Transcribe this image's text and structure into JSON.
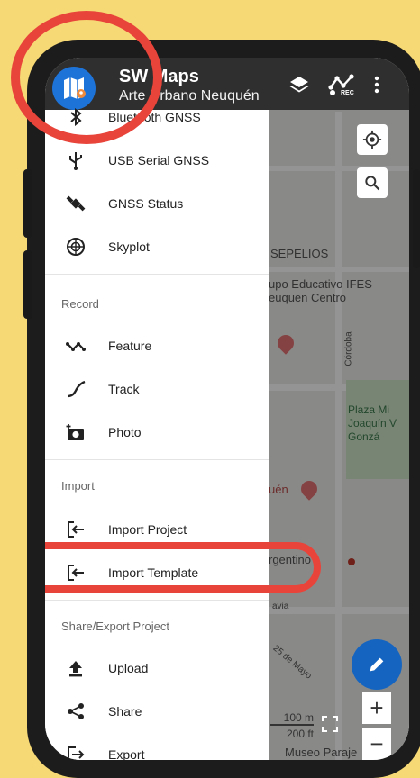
{
  "app": {
    "title": "SW Maps",
    "project": "Arte Urbano Neuquén",
    "rec_badge": "REC"
  },
  "drawer": {
    "sections": [
      {
        "items": [
          {
            "label": "Bluetooth GNSS",
            "icon": "bluetooth-icon"
          },
          {
            "label": "USB Serial GNSS",
            "icon": "usb-icon"
          },
          {
            "label": "GNSS Status",
            "icon": "satellite-icon"
          },
          {
            "label": "Skyplot",
            "icon": "skyplot-icon"
          }
        ]
      },
      {
        "header": "Record",
        "items": [
          {
            "label": "Feature",
            "icon": "feature-icon"
          },
          {
            "label": "Track",
            "icon": "track-icon"
          },
          {
            "label": "Photo",
            "icon": "camera-icon"
          }
        ]
      },
      {
        "header": "Import",
        "items": [
          {
            "label": "Import Project",
            "icon": "import-icon"
          },
          {
            "label": "Import Template",
            "icon": "import-icon"
          }
        ]
      },
      {
        "header": "Share/Export Project",
        "items": [
          {
            "label": "Upload",
            "icon": "upload-icon"
          },
          {
            "label": "Share",
            "icon": "share-icon"
          },
          {
            "label": "Export",
            "icon": "export-icon"
          }
        ]
      }
    ]
  },
  "map": {
    "labels": {
      "sepelios": "SEPELIOS",
      "educativo": "upo Educativo IFES\neuquen Centro",
      "cordoba": "Córdoba",
      "plaza": "Plaza Mi\nJoaquín V\nGonzá",
      "uen": "uén",
      "argentino": "rgentino -",
      "avia": "avia",
      "mayo": "25 de Mayo",
      "museo": "Museo Paraje"
    },
    "scale": {
      "meters": "100 m",
      "feet": "200 ft"
    },
    "zoom": {
      "in": "+",
      "out": "−"
    }
  },
  "colors": {
    "accent": "#1565c0",
    "annotation": "#e8443a",
    "background": "#f6d874"
  }
}
